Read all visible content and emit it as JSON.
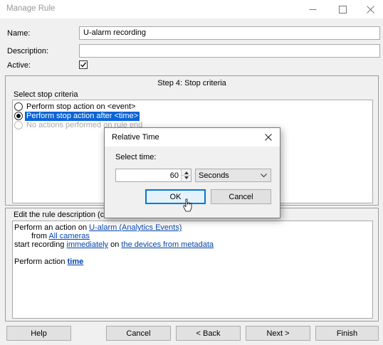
{
  "window": {
    "title": "Manage Rule"
  },
  "form": {
    "name_label": "Name:",
    "name_value": "U-alarm recording",
    "description_label": "Description:",
    "description_value": "",
    "active_label": "Active:",
    "active_checked": true
  },
  "step": {
    "title": "Step 4: Stop criteria",
    "select_label": "Select stop criteria",
    "options": [
      {
        "label": "Perform stop action on <event>",
        "selected": false,
        "disabled": false
      },
      {
        "label": "Perform stop action after <time>",
        "selected": true,
        "disabled": false
      },
      {
        "label": "No actions performed on rule end",
        "selected": false,
        "disabled": true
      }
    ]
  },
  "description_panel": {
    "heading": "Edit the rule description (click",
    "line1_prefix": "Perform an action on ",
    "line1_link": "U-alarm (Analytics Events)",
    "line2_prefix": "from ",
    "line2_link": "All cameras",
    "line3_prefix": "start recording ",
    "line3_link1": "immediately",
    "line3_middle": " on ",
    "line3_link2": "the devices from metadata",
    "line4_prefix": "Perform action ",
    "line4_link": "time"
  },
  "footer": {
    "help": "Help",
    "cancel": "Cancel",
    "back": "< Back",
    "next": "Next >",
    "finish": "Finish"
  },
  "dialog": {
    "title": "Relative Time",
    "select_time_label": "Select time:",
    "time_value": "60",
    "unit_value": "Seconds",
    "ok": "OK",
    "cancel": "Cancel"
  }
}
